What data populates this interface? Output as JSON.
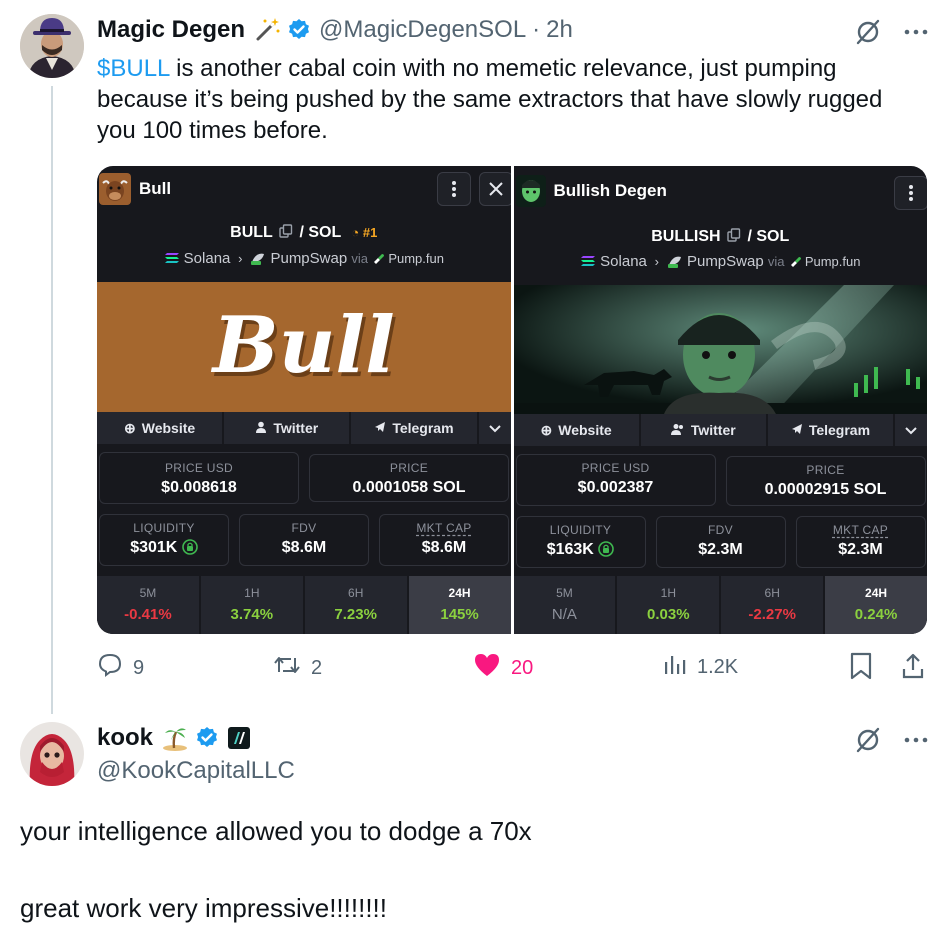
{
  "tweet": {
    "display_name": "Magic Degen",
    "handle": "@MagicDegenSOL",
    "separator": "·",
    "time": "2h",
    "text_link": "$BULL",
    "text_line1_rest": " is another cabal coin with no memetic relevance, just pumping",
    "text_line2": "because it’s being pushed by the same extractors that have slowly rugged",
    "text_line3": "you 100 times before.",
    "reply_count": "9",
    "retweet_count": "2",
    "like_count": "20",
    "view_count": "1.2K",
    "colors": {
      "link": "#1d9bf0",
      "like": "#f91880",
      "verified": "#1d9bf0"
    }
  },
  "cards": [
    {
      "title": "Bull",
      "pair_base": "BULL",
      "pair_sep": "/ SOL",
      "rank": "#1",
      "chain": "Solana",
      "dex": "PumpSwap",
      "via": "via",
      "launchpad": "Pump.fun",
      "banner_text": "Bull",
      "links": [
        "Website",
        "Twitter",
        "Telegram"
      ],
      "price_usd_label": "PRICE USD",
      "price_usd": "$0.008618",
      "price_label": "PRICE",
      "price_sol": "0.0001058 SOL",
      "liquidity_label": "LIQUIDITY",
      "liquidity": "$301K",
      "fdv_label": "FDV",
      "fdv": "$8.6M",
      "mcap_label": "MKT CAP",
      "mcap": "$8.6M",
      "changes": [
        {
          "label": "5M",
          "value": "-0.41%",
          "tone": "neg"
        },
        {
          "label": "1H",
          "value": "3.74%",
          "tone": "pos"
        },
        {
          "label": "6H",
          "value": "7.23%",
          "tone": "pos"
        },
        {
          "label": "24H",
          "value": "145%",
          "tone": "pos"
        }
      ]
    },
    {
      "title": "Bullish Degen",
      "pair_base": "BULLISH",
      "pair_sep": "/ SOL",
      "chain": "Solana",
      "dex": "PumpSwap",
      "via": "via",
      "launchpad": "Pump.fun",
      "links": [
        "Website",
        "Twitter",
        "Telegram"
      ],
      "price_usd_label": "PRICE USD",
      "price_usd": "$0.002387",
      "price_label": "PRICE",
      "price_sol": "0.00002915 SOL",
      "liquidity_label": "LIQUIDITY",
      "liquidity": "$163K",
      "fdv_label": "FDV",
      "fdv": "$2.3M",
      "mcap_label": "MKT CAP",
      "mcap": "$2.3M",
      "changes": [
        {
          "label": "5M",
          "value": "N/A",
          "tone": "na"
        },
        {
          "label": "1H",
          "value": "0.03%",
          "tone": "pos"
        },
        {
          "label": "6H",
          "value": "-2.27%",
          "tone": "neg"
        },
        {
          "label": "24H",
          "value": "0.24%",
          "tone": "pos"
        }
      ]
    }
  ],
  "reply": {
    "display_name": "kook",
    "handle": "@KookCapitalLLC",
    "line1": "your intelligence allowed you to dodge a 70x",
    "line2": "great work very impressive!!!!!!!!"
  }
}
